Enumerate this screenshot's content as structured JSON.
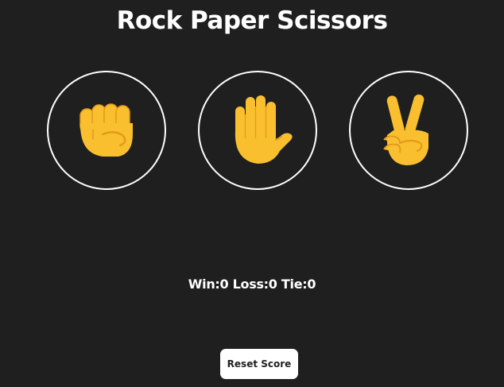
{
  "title": "Rock Paper Scissors",
  "choices": [
    {
      "name": "rock",
      "icon": "raised-fist-icon"
    },
    {
      "name": "paper",
      "icon": "raised-hand-icon"
    },
    {
      "name": "scissors",
      "icon": "victory-hand-icon"
    }
  ],
  "score": {
    "win_label": "Win:",
    "win": "0",
    "loss_label": " Loss:",
    "loss": "0",
    "tie_label": " Tie:",
    "tie": "0"
  },
  "reset_label": "Reset Score",
  "colors": {
    "background": "#1f1f1f",
    "circle_border": "#ffffff",
    "emoji_fill": "#f9bf2f",
    "emoji_shade": "#e39a1a",
    "button_bg": "#ffffff",
    "button_text": "#1f1f1f"
  }
}
